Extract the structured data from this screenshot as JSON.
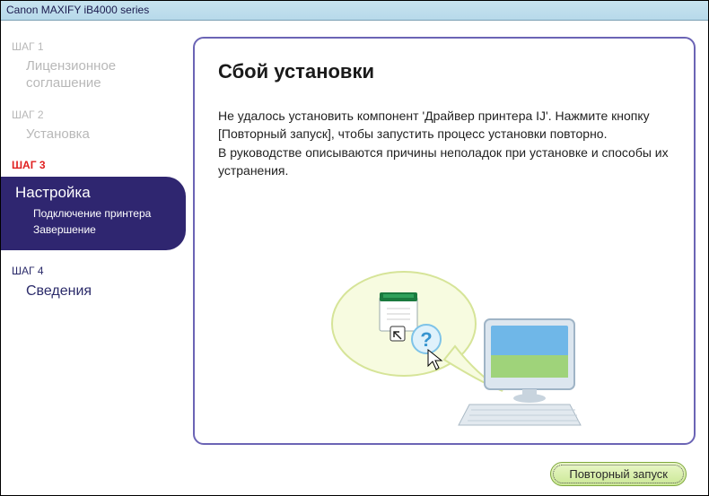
{
  "title": "Canon MAXIFY iB4000 series",
  "sidebar": {
    "step1": {
      "label": "ШАГ 1",
      "name": "Лицензионное соглашение"
    },
    "step2": {
      "label": "ШАГ 2",
      "name": "Установка"
    },
    "step3": {
      "label": "ШАГ 3",
      "name": "Настройка",
      "subitems": [
        "Подключение принтера",
        "Завершение"
      ]
    },
    "step4": {
      "label": "ШАГ 4",
      "name": "Сведения"
    }
  },
  "content": {
    "heading": "Сбой установки",
    "para1": "Не удалось установить компонент 'Драйвер принтера IJ'. Нажмите кнопку [Повторный запуск], чтобы запустить процесс установки повторно.",
    "para2": "В руководстве описываются причины неполадок при установке и способы их устранения."
  },
  "footer": {
    "retry": "Повторный запуск"
  }
}
